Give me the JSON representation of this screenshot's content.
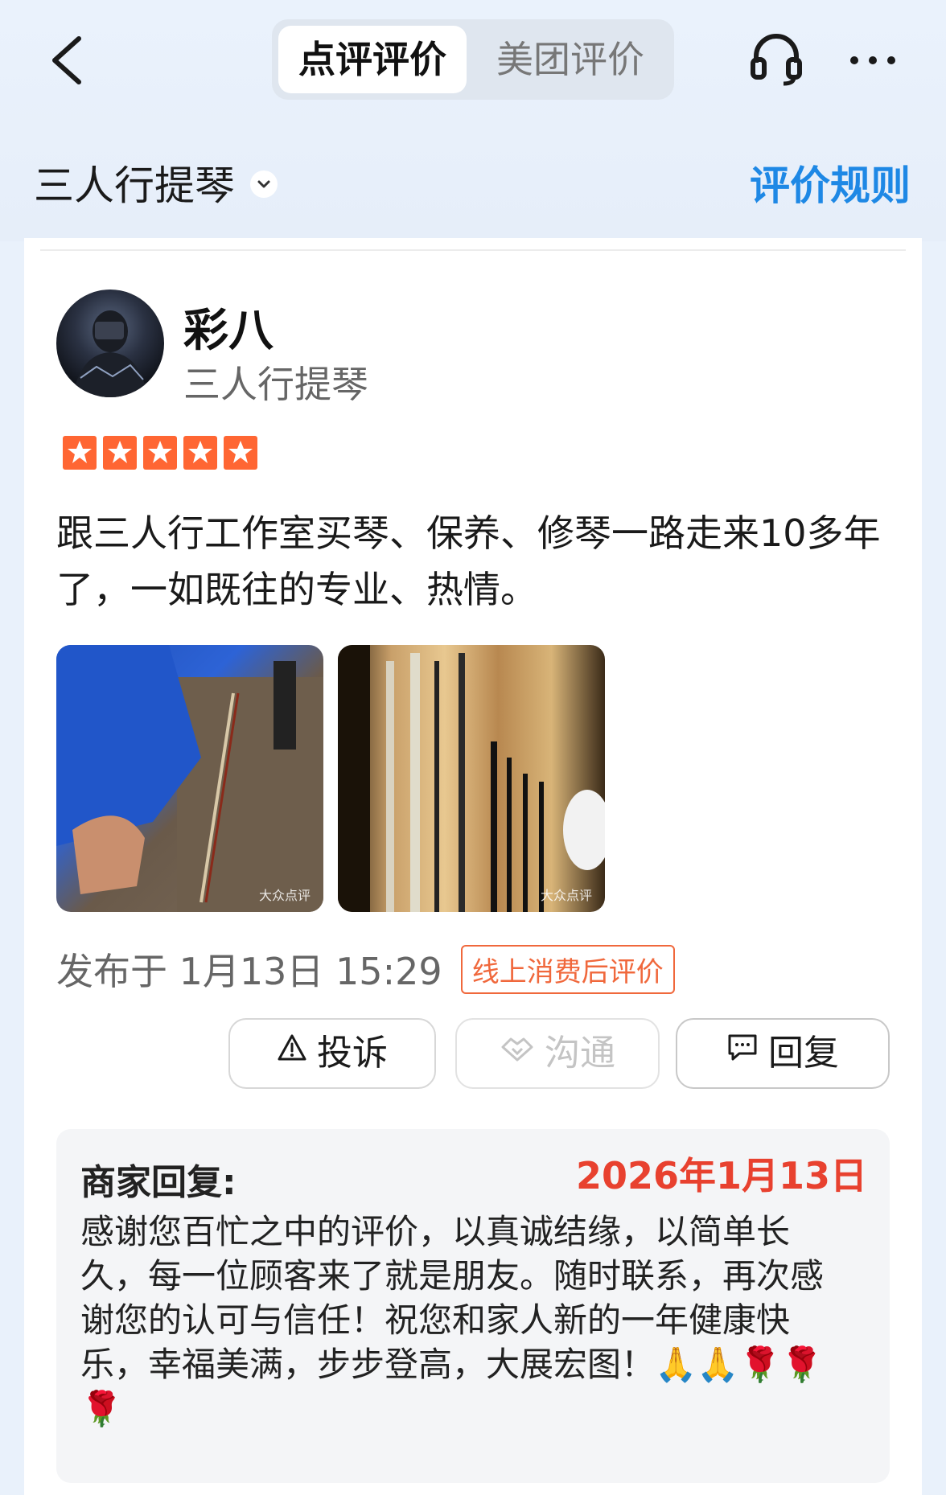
{
  "header": {
    "tabs": [
      {
        "label": "点评评价",
        "active": true
      },
      {
        "label": "美团评价",
        "active": false
      }
    ],
    "icons": {
      "back": "chevron-left-icon",
      "support": "headset-icon",
      "more": "more-icon"
    }
  },
  "shop_bar": {
    "shop_name": "三人行提琴",
    "rules_link": "评价规则",
    "accent_color": "#1e88e5"
  },
  "review": {
    "user_name": "彩八",
    "user_shop": "三人行提琴",
    "rating": 5,
    "rating_max": 5,
    "text": "跟三人行工作室买琴、保养、修琴一路走来10多年了，一如既往的专业、热情。",
    "photos": [
      {
        "watermark": "大众点评"
      },
      {
        "watermark": "大众点评"
      }
    ],
    "publish_text": "发布于 1月13日 15:29",
    "tag": "线上消费后评价"
  },
  "actions": {
    "complain": "投诉",
    "chat": "沟通",
    "reply": "回复"
  },
  "merchant_reply": {
    "title": "商家回复:",
    "date": "2026年1月13日",
    "text": "感谢您百忙之中的评价，以真诚结缘，以简单长久，每一位顾客来了就是朋友。随时联系，再次感谢您的认可与信任！祝您和家人新的一年健康快乐，幸福美满，步步登高，大展宏图！🙏🙏🌹🌹🌹"
  }
}
